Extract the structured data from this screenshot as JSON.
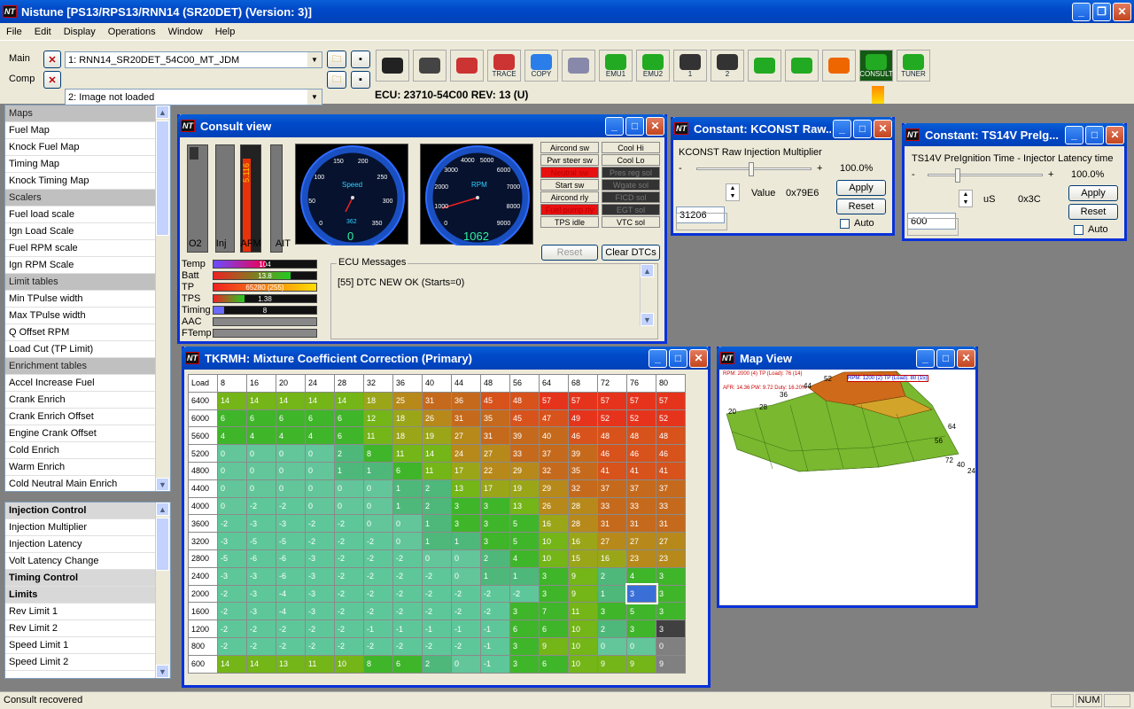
{
  "app": {
    "title": "Nistune [PS13/RPS13/RNN14 (SR20DET) (Version: 3)]",
    "logo": "NT"
  },
  "menu": [
    "File",
    "Edit",
    "Display",
    "Operations",
    "Window",
    "Help"
  ],
  "toolbar": {
    "main_label": "Main",
    "comp_label": "Comp",
    "main_value": "1: RNN14_SR20DET_54C00_MT_JDM",
    "comp_value": "2: Image not loaded",
    "ecu": "ECU: 23710-54C00 REV: 13 (U)",
    "buttons": [
      {
        "name": "speedo",
        "label": ""
      },
      {
        "name": "gauges",
        "label": ""
      },
      {
        "name": "graph",
        "label": ""
      },
      {
        "name": "trace",
        "label": "TRACE"
      },
      {
        "name": "copy",
        "label": "COPY"
      },
      {
        "name": "search",
        "label": ""
      },
      {
        "name": "emu1",
        "label": "EMU1"
      },
      {
        "name": "emu2",
        "label": "EMU2"
      },
      {
        "name": "tool1",
        "label": "1"
      },
      {
        "name": "tool2",
        "label": "2"
      },
      {
        "name": "download",
        "label": ""
      },
      {
        "name": "upload",
        "label": ""
      },
      {
        "name": "fire",
        "label": ""
      },
      {
        "name": "consult",
        "label": "CONSULT"
      },
      {
        "name": "tuner",
        "label": "TUNER"
      }
    ]
  },
  "sidebar_top": [
    {
      "label": "Maps",
      "type": "hdr"
    },
    {
      "label": "Fuel Map"
    },
    {
      "label": "Knock Fuel Map"
    },
    {
      "label": "Timing Map"
    },
    {
      "label": "Knock Timing Map"
    },
    {
      "label": "Scalers",
      "type": "hdr"
    },
    {
      "label": "Fuel load scale"
    },
    {
      "label": "Ign Load Scale"
    },
    {
      "label": "Fuel RPM scale"
    },
    {
      "label": "Ign RPM Scale"
    },
    {
      "label": "Limit tables",
      "type": "hdr"
    },
    {
      "label": "Min TPulse width"
    },
    {
      "label": "Max TPulse width"
    },
    {
      "label": "Q Offset RPM"
    },
    {
      "label": "Load Cut (TP Limit)"
    },
    {
      "label": "Enrichment tables",
      "type": "hdr"
    },
    {
      "label": "Accel Increase Fuel"
    },
    {
      "label": "Crank Enrich"
    },
    {
      "label": "Crank Enrich Offset"
    },
    {
      "label": "Engine Crank Offset"
    },
    {
      "label": "Cold Enrich"
    },
    {
      "label": "Warm Enrich"
    },
    {
      "label": "Cold Neutral Main Enrich"
    }
  ],
  "sidebar_bottom": [
    {
      "label": "Injection Control",
      "type": "bold"
    },
    {
      "label": "Injection Multiplier"
    },
    {
      "label": "Injection Latency"
    },
    {
      "label": "Volt Latency Change"
    },
    {
      "label": "Timing Control",
      "type": "bold"
    },
    {
      "label": "Limits",
      "type": "bold"
    },
    {
      "label": "Rev Limit 1"
    },
    {
      "label": "Rev Limit 2"
    },
    {
      "label": "Speed Limit 1"
    },
    {
      "label": "Speed Limit 2"
    }
  ],
  "consult": {
    "title": "Consult view",
    "bar_labels": [
      "O2",
      "Inj",
      "AFM",
      "AIT"
    ],
    "afm_text": "5.116",
    "speed": {
      "label": "Speed",
      "value": "0",
      "odo": "362",
      "ticks": [
        "0",
        "50",
        "100",
        "150",
        "200",
        "250",
        "300",
        "350"
      ]
    },
    "rpm": {
      "label": "RPM",
      "value": "1062",
      "ticks": [
        "0",
        "1000",
        "2000",
        "3000",
        "4000",
        "5000",
        "6000",
        "7000",
        "8000",
        "9000"
      ]
    },
    "switches": [
      [
        "Aircond sw",
        "Cool Hi"
      ],
      [
        "Pwr steer sw",
        "Cool Lo"
      ],
      [
        "Neutral sw",
        "Pres reg sol"
      ],
      [
        "Start sw",
        "Wgate sol"
      ],
      [
        "Aircond rly",
        "FICD sol"
      ],
      [
        "Fuel pump rly",
        "EGT sol"
      ],
      [
        "TPS idle",
        "VTC sol"
      ]
    ],
    "switch_state": [
      [
        "off",
        "off"
      ],
      [
        "off",
        "off"
      ],
      [
        "red",
        "dark"
      ],
      [
        "off",
        "dark"
      ],
      [
        "off",
        "dark"
      ],
      [
        "red",
        "dark"
      ],
      [
        "off",
        "off"
      ]
    ],
    "reset": "Reset",
    "clear": "Clear DTCs",
    "gauges": [
      {
        "label": "Temp",
        "text": "104",
        "fill": 0.5
      },
      {
        "label": "Batt",
        "text": "13.8",
        "fill": 0.75
      },
      {
        "label": "TP",
        "text": "65280 (255)",
        "fill": 1
      },
      {
        "label": "TPS",
        "text": "1.38",
        "fill": 0.3
      },
      {
        "label": "Timing",
        "text": "8",
        "fill": 0.1
      },
      {
        "label": "AAC",
        "text": "",
        "fill": 0
      },
      {
        "label": "FTemp",
        "text": "",
        "fill": 0
      }
    ],
    "ecu_messages_label": "ECU Messages",
    "ecu_message": "[55] DTC NEW OK (Starts=0)"
  },
  "kconst": {
    "title": "Constant: KCONST Raw...",
    "desc": "KCONST Raw Injection Multiplier",
    "minus": "-",
    "plus": "+",
    "percent": "100.0%",
    "value": "31206",
    "value_label": "Value",
    "hex": "0x79E6",
    "apply": "Apply",
    "reset": "Reset",
    "auto": "Auto"
  },
  "ts14v": {
    "title": "Constant: TS14V Prelg...",
    "desc": "TS14V PreIgnition Time - Injector Latency time",
    "minus": "-",
    "plus": "+",
    "percent": "100.0%",
    "value": "600",
    "unit": "uS",
    "hex": "0x3C",
    "apply": "Apply",
    "reset": "Reset",
    "auto": "Auto"
  },
  "map_window": {
    "title": "TKRMH: Mixture Coefficient Correction (Primary)",
    "corner": "Load",
    "cols": [
      "8",
      "16",
      "20",
      "24",
      "28",
      "32",
      "36",
      "40",
      "44",
      "48",
      "56",
      "64",
      "68",
      "72",
      "76",
      "80"
    ],
    "rows": [
      {
        "rpm": "6400",
        "v": [
          14,
          14,
          14,
          14,
          14,
          18,
          25,
          31,
          36,
          45,
          48,
          57,
          57,
          57,
          57,
          57
        ]
      },
      {
        "rpm": "6000",
        "v": [
          6,
          6,
          6,
          6,
          6,
          12,
          18,
          26,
          31,
          35,
          45,
          47,
          49,
          52,
          52,
          52
        ]
      },
      {
        "rpm": "5600",
        "v": [
          4,
          4,
          4,
          4,
          6,
          11,
          18,
          19,
          27,
          31,
          39,
          40,
          46,
          48,
          48,
          48
        ]
      },
      {
        "rpm": "5200",
        "v": [
          0,
          0,
          0,
          0,
          2,
          8,
          11,
          14,
          24,
          27,
          33,
          37,
          39,
          46,
          46,
          46
        ]
      },
      {
        "rpm": "4800",
        "v": [
          0,
          0,
          0,
          0,
          1,
          1,
          6,
          11,
          17,
          22,
          29,
          32,
          35,
          41,
          41,
          41
        ]
      },
      {
        "rpm": "4400",
        "v": [
          0,
          0,
          0,
          0,
          0,
          0,
          1,
          2,
          13,
          17,
          19,
          29,
          32,
          37,
          37,
          37
        ]
      },
      {
        "rpm": "4000",
        "v": [
          0,
          -2,
          -2,
          0,
          0,
          0,
          1,
          2,
          3,
          3,
          13,
          26,
          28,
          33,
          33,
          33
        ]
      },
      {
        "rpm": "3600",
        "v": [
          -2,
          -3,
          -3,
          -2,
          -2,
          0,
          0,
          1,
          3,
          3,
          5,
          16,
          28,
          31,
          31,
          31
        ]
      },
      {
        "rpm": "3200",
        "v": [
          -3,
          -5,
          -5,
          -2,
          -2,
          -2,
          0,
          1,
          1,
          3,
          5,
          10,
          16,
          27,
          27,
          27
        ]
      },
      {
        "rpm": "2800",
        "v": [
          -5,
          -6,
          -6,
          -3,
          -2,
          -2,
          -2,
          0,
          0,
          2,
          4,
          10,
          15,
          16,
          23,
          23
        ]
      },
      {
        "rpm": "2400",
        "v": [
          -3,
          -3,
          -6,
          -3,
          -2,
          -2,
          -2,
          -2,
          0,
          1,
          1,
          3,
          9,
          2,
          4,
          3
        ]
      },
      {
        "rpm": "2000",
        "v": [
          -2,
          -3,
          -4,
          -3,
          -2,
          -2,
          -2,
          -2,
          -2,
          -2,
          -2,
          3,
          9,
          1,
          3,
          3
        ]
      },
      {
        "rpm": "1600",
        "v": [
          -2,
          -3,
          -4,
          -3,
          -2,
          -2,
          -2,
          -2,
          -2,
          -2,
          3,
          7,
          11,
          3,
          5,
          3
        ]
      },
      {
        "rpm": "1200",
        "v": [
          -2,
          -2,
          -2,
          -2,
          -2,
          -1,
          -1,
          -1,
          -1,
          -1,
          6,
          6,
          10,
          2,
          3,
          3
        ]
      },
      {
        "rpm": "800",
        "v": [
          -2,
          -2,
          -2,
          -2,
          -2,
          -2,
          -2,
          -2,
          -2,
          -1,
          3,
          9,
          10,
          0,
          0,
          0
        ]
      },
      {
        "rpm": "600",
        "v": [
          14,
          14,
          13,
          11,
          10,
          8,
          6,
          2,
          0,
          -1,
          3,
          6,
          10,
          9,
          9,
          9
        ]
      }
    ]
  },
  "map_view": {
    "title": "Map View",
    "overlay1": "RPM: 2000 (4)  TP (Load): 76 (14)",
    "overlay2": "AFR: 14.36  PW: 9.72  Duty: 16.20%",
    "overlay3": "RPM: 1200 (2)  TP (Load): 80 (15)",
    "axis": [
      "20",
      "28",
      "36",
      "44",
      "52",
      "64",
      "72",
      "56",
      "40",
      "24"
    ]
  },
  "status": {
    "text": "Consult recovered",
    "num": "NUM"
  },
  "colors": {
    "titlebar": "#0054e3",
    "desktop": "#808080",
    "menubar": "#ece9d8"
  }
}
